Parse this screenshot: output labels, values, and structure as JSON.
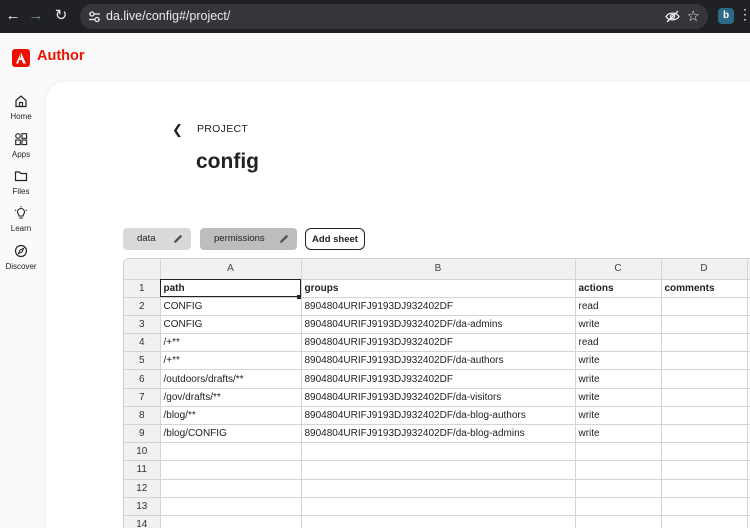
{
  "browser": {
    "url": "da.live/config#/project/",
    "extension_badge": "b"
  },
  "app": {
    "brand": "Author",
    "brand_color": "#eb1000"
  },
  "rail": [
    {
      "label": "Home",
      "icon": "home-icon"
    },
    {
      "label": "Apps",
      "icon": "apps-icon"
    },
    {
      "label": "Files",
      "icon": "folder-icon"
    },
    {
      "label": "Learn",
      "icon": "lightbulb-icon"
    },
    {
      "label": "Discover",
      "icon": "compass-icon"
    }
  ],
  "page": {
    "breadcrumb": "PROJECT",
    "title": "config"
  },
  "sheet_tabs": [
    {
      "label": "data"
    },
    {
      "label": "permissions"
    }
  ],
  "add_sheet_label": "Add sheet",
  "sheet": {
    "column_letters": [
      "A",
      "B",
      "C",
      "D"
    ],
    "rows": [
      {
        "num": "1",
        "cells": [
          "path",
          "groups",
          "actions",
          "comments"
        ]
      },
      {
        "num": "2",
        "cells": [
          "CONFIG",
          "8904804URIFJ9193DJ932402DF",
          "read",
          ""
        ]
      },
      {
        "num": "3",
        "cells": [
          "CONFIG",
          "8904804URIFJ9193DJ932402DF/da-admins",
          "write",
          ""
        ]
      },
      {
        "num": "4",
        "cells": [
          "/+**",
          "8904804URIFJ9193DJ932402DF",
          "read",
          ""
        ]
      },
      {
        "num": "5",
        "cells": [
          "/+**",
          "8904804URIFJ9193DJ932402DF/da-authors",
          "write",
          ""
        ]
      },
      {
        "num": "6",
        "cells": [
          "/outdoors/drafts/**",
          "8904804URIFJ9193DJ932402DF",
          "write",
          ""
        ]
      },
      {
        "num": "7",
        "cells": [
          "/gov/drafts/**",
          "8904804URIFJ9193DJ932402DF/da-visitors",
          "write",
          ""
        ]
      },
      {
        "num": "8",
        "cells": [
          "/blog/**",
          "8904804URIFJ9193DJ932402DF/da-blog-authors",
          "write",
          ""
        ]
      },
      {
        "num": "9",
        "cells": [
          "/blog/CONFIG",
          "8904804URIFJ9193DJ932402DF/da-blog-admins",
          "write",
          ""
        ]
      },
      {
        "num": "10",
        "cells": [
          "",
          "",
          "",
          ""
        ]
      },
      {
        "num": "11",
        "cells": [
          "",
          "",
          "",
          ""
        ]
      },
      {
        "num": "12",
        "cells": [
          "",
          "",
          "",
          ""
        ]
      },
      {
        "num": "13",
        "cells": [
          "",
          "",
          "",
          ""
        ]
      },
      {
        "num": "14",
        "cells": [
          "",
          "",
          "",
          ""
        ]
      }
    ]
  }
}
